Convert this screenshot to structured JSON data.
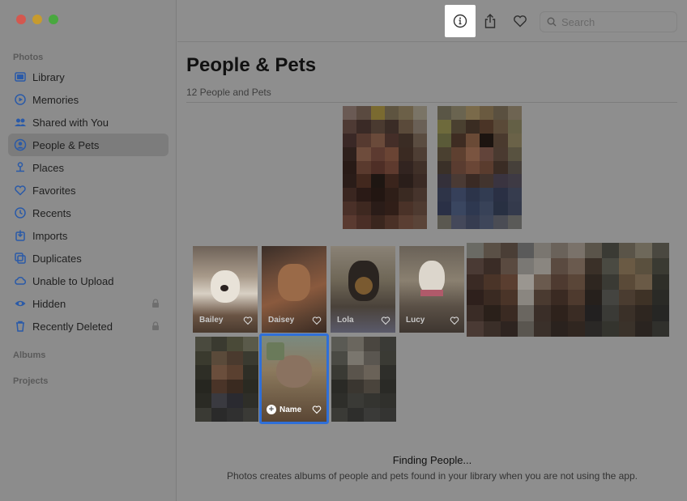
{
  "sidebar": {
    "photos_header": "Photos",
    "albums_header": "Albums",
    "projects_header": "Projects",
    "items": [
      {
        "label": "Library",
        "icon": "library-icon"
      },
      {
        "label": "Memories",
        "icon": "memories-icon"
      },
      {
        "label": "Shared with You",
        "icon": "shared-with-you-icon"
      },
      {
        "label": "People & Pets",
        "icon": "people-icon",
        "selected": true
      },
      {
        "label": "Places",
        "icon": "pin-icon"
      },
      {
        "label": "Favorites",
        "icon": "heart-icon"
      },
      {
        "label": "Recents",
        "icon": "clock-icon"
      },
      {
        "label": "Imports",
        "icon": "import-icon"
      },
      {
        "label": "Duplicates",
        "icon": "duplicates-icon"
      },
      {
        "label": "Unable to Upload",
        "icon": "cloud-icon"
      },
      {
        "label": "Hidden",
        "icon": "eye-icon",
        "locked": true
      },
      {
        "label": "Recently Deleted",
        "icon": "trash-icon",
        "locked": true
      }
    ]
  },
  "toolbar": {
    "search_placeholder": "Search"
  },
  "main": {
    "title": "People & Pets",
    "subtitle": "12 People and Pets",
    "tiles": [
      {
        "label": "Bailey"
      },
      {
        "label": "Daisey"
      },
      {
        "label": "Lola"
      },
      {
        "label": "Lucy"
      }
    ],
    "name_button_label": "Name",
    "finding_title": "Finding People...",
    "finding_desc": "Photos creates albums of people and pets found in your library when you are not using the app."
  },
  "colors": {
    "selection_border": "#2f6fd8",
    "highlight": "#ffffff"
  }
}
